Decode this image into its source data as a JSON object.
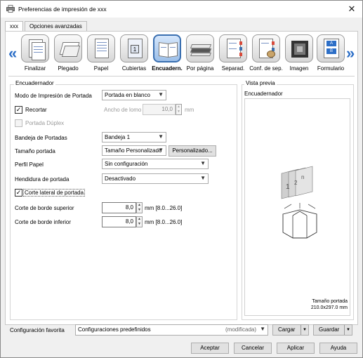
{
  "window": {
    "title": "Preferencias de impresión de xxx",
    "close_glyph": "✕"
  },
  "tabs": [
    {
      "label": "xxx"
    },
    {
      "label": "Opciones avanzadas"
    }
  ],
  "ribbon": {
    "left_arrow": "«",
    "right_arrow": "»",
    "items": [
      {
        "label": "Finalizar",
        "icon": "finishing-icon"
      },
      {
        "label": "Plegado",
        "icon": "folding-icon"
      },
      {
        "label": "Papel",
        "icon": "paper-icon"
      },
      {
        "label": "Cubiertas",
        "icon": "covers-icon"
      },
      {
        "label": "Encuadern.",
        "icon": "binding-icon"
      },
      {
        "label": "Por página",
        "icon": "per-page-icon"
      },
      {
        "label": "Separad.",
        "icon": "separator-icon"
      },
      {
        "label": "Conf. de sep.",
        "icon": "separator-settings-icon"
      },
      {
        "label": "Imagen",
        "icon": "image-icon"
      },
      {
        "label": "Formulario",
        "icon": "form-icon"
      }
    ],
    "cover_number": "1"
  },
  "binder": {
    "group_title": "Encuadernador",
    "print_mode_label": "Modo de Impresión de Portada",
    "print_mode_value": "Portada en blanco",
    "trim_label": "Recortar",
    "trim_checked": "✓",
    "spine_width_label": "Ancho de lomo",
    "spine_width_value": "10,0",
    "spine_width_unit": "mm",
    "duplex_cover_label": "Portada Dúplex",
    "cover_tray_label": "Bandeja de Portadas",
    "cover_tray_value": "Bandeja 1",
    "cover_size_label": "Tamaño portada",
    "cover_size_value": "Tamaño Personalizado",
    "custom_button": "Personalizado...",
    "paper_profile_label": "Perfil Papel",
    "paper_profile_value": "Sin configuración",
    "crease_label": "Hendidura de portada",
    "crease_value": "Desactivado",
    "side_cut_label": "Corte lateral de portada",
    "side_cut_checked": "✓",
    "top_cut_label": "Corte de borde superior",
    "top_cut_value": "8,0",
    "top_cut_range": "mm [8.0...26.0]",
    "bottom_cut_label": "Corte de borde inferior",
    "bottom_cut_value": "8,0",
    "bottom_cut_range": "mm [8.0...26.0]"
  },
  "preview": {
    "group_title": "Vista previa",
    "subtitle": "Encuadernador",
    "page_numbers": [
      "1",
      "2",
      "n"
    ],
    "size_label": "Tamaño portada",
    "size_value": "210.0x297.0 mm"
  },
  "favorites": {
    "label": "Configuración favorita",
    "value": "Configuraciones predefinidos",
    "modified": "(modificada)",
    "load_button": "Cargar",
    "save_button": "Guardar"
  },
  "footer": {
    "ok": "Aceptar",
    "cancel": "Cancelar",
    "apply": "Aplicar",
    "help": "Ayuda"
  },
  "colors": {
    "accent": "#2d6fc7",
    "selected_tab": "#9cbfe8"
  }
}
